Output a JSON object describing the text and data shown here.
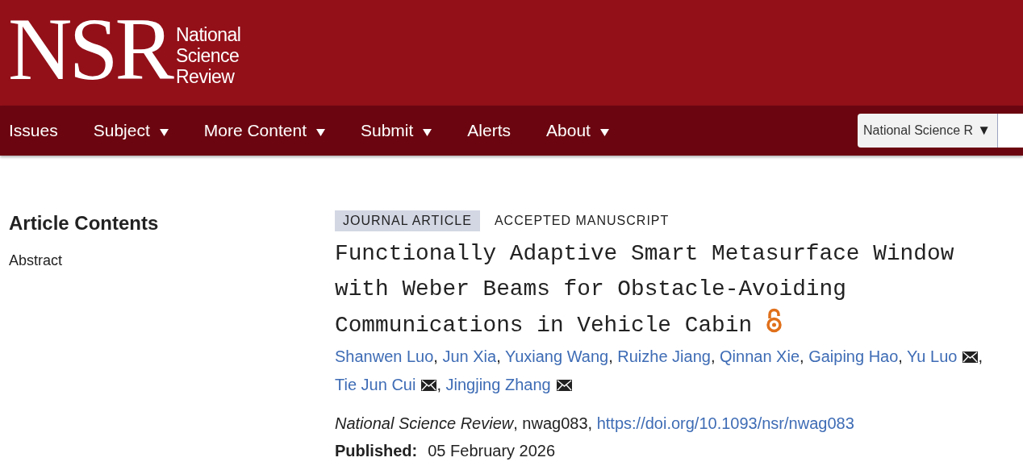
{
  "header": {
    "logo_letters": "NSR",
    "logo_words": [
      "National",
      "Science",
      "Review"
    ]
  },
  "nav": {
    "items": [
      {
        "label": "Issues",
        "has_menu": false
      },
      {
        "label": "Subject",
        "has_menu": true
      },
      {
        "label": "More Content",
        "has_menu": true
      },
      {
        "label": "Submit",
        "has_menu": true
      },
      {
        "label": "Alerts",
        "has_menu": false
      },
      {
        "label": "About",
        "has_menu": true
      }
    ],
    "search_scope": {
      "value": "National Science R",
      "caret": "▼"
    }
  },
  "sidebar": {
    "title": "Article Contents",
    "items": [
      "Abstract"
    ]
  },
  "article": {
    "tags": [
      {
        "label": "JOURNAL ARTICLE",
        "highlighted": true
      },
      {
        "label": "ACCEPTED MANUSCRIPT",
        "highlighted": false
      }
    ],
    "title": "Functionally Adaptive Smart Metasurface Window with Weber Beams for Obstacle-Avoiding Communications in Vehicle Cabin",
    "open_access": true,
    "authors": [
      {
        "name": "Shanwen Luo",
        "email": false
      },
      {
        "name": "Jun Xia",
        "email": false
      },
      {
        "name": "Yuxiang Wang",
        "email": false
      },
      {
        "name": "Ruizhe Jiang",
        "email": false
      },
      {
        "name": "Qinnan Xie",
        "email": false
      },
      {
        "name": "Gaiping Hao",
        "email": false
      },
      {
        "name": "Yu Luo",
        "email": true
      },
      {
        "name": "Tie Jun Cui",
        "email": true
      },
      {
        "name": "Jingjing Zhang",
        "email": true
      }
    ],
    "separator": ", ",
    "citation": "*National Science Review*, nwag083, ",
    "doi": "https://doi.org/10.1093/nsr/nwag083",
    "published_label": "Published:",
    "published_date": "05 February 2026"
  }
}
